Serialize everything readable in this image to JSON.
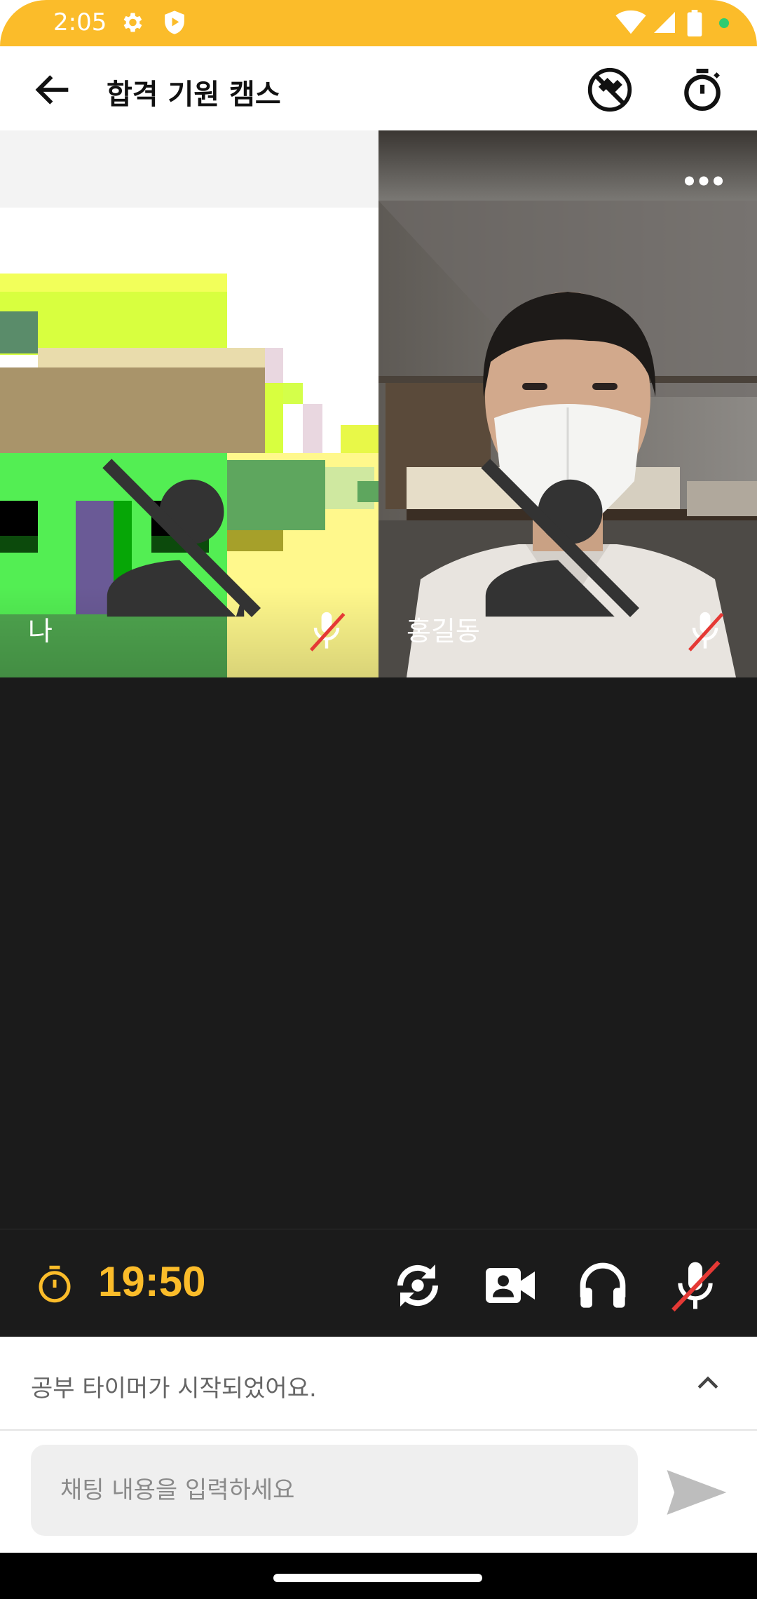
{
  "status_bar": {
    "time": "2:05",
    "icons": [
      "settings-icon",
      "play-protect-icon",
      "wifi-icon",
      "signal-icon",
      "battery-icon",
      "notification-dot-icon"
    ]
  },
  "app_bar": {
    "title": "합격 기원 캠스",
    "back_icon": "arrow-left-icon",
    "actions": [
      "no-sleep-icon",
      "stopwatch-icon"
    ]
  },
  "participants": [
    {
      "name": "나",
      "muted": true,
      "video": "pixel-art-avatar"
    },
    {
      "name": "홍길동",
      "muted": true,
      "video": "camera-feed"
    },
    {
      "name": "",
      "empty": true
    },
    {
      "name": "",
      "empty": true
    }
  ],
  "controls": {
    "timer": "19:50",
    "buttons": [
      "switch-camera-icon",
      "video-camera-icon",
      "headphones-icon",
      "mic-off-icon"
    ]
  },
  "notice": {
    "text": "공부 타이머가 시작되었어요."
  },
  "chat": {
    "placeholder": "채팅 내용을 입력하세요"
  },
  "colors": {
    "accent": "#FBBC2A",
    "dark_bg": "#1B1B1B",
    "mute_red": "#E53935"
  }
}
